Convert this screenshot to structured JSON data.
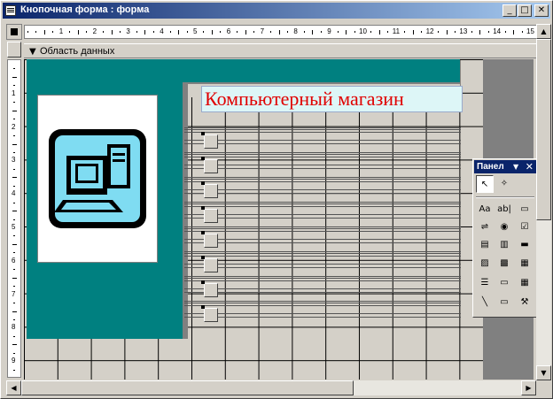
{
  "window": {
    "title": "Кнопочная форма : форма",
    "minimize_glyph": "_",
    "maximize_glyph": "□",
    "close_glyph": "✕"
  },
  "ruler": {
    "h_numbers": [
      "1",
      "2",
      "3",
      "4",
      "5",
      "6",
      "7",
      "8",
      "9",
      "10",
      "11",
      "12",
      "13",
      "14",
      "15"
    ],
    "v_numbers": [
      "1",
      "2",
      "3",
      "4",
      "5",
      "6",
      "7",
      "8",
      "9"
    ]
  },
  "section": {
    "arrow_glyph": "▼",
    "label": "Область данных"
  },
  "form": {
    "title_label": "Компьютерный магазин",
    "switch_button_count": 8,
    "image": "computer-icon"
  },
  "toolbox": {
    "title": "Панел",
    "dropdown_glyph": "▼",
    "close_glyph": "✕",
    "tools": [
      {
        "name": "select-objects-tool",
        "glyph": "↖"
      },
      {
        "name": "control-wizards-tool",
        "glyph": "✧"
      },
      {
        "name": "label-tool",
        "glyph": "Aa"
      },
      {
        "name": "textbox-tool",
        "glyph": "ab|"
      },
      {
        "name": "option-group-tool",
        "glyph": "▭"
      },
      {
        "name": "toggle-button-tool",
        "glyph": "⇌"
      },
      {
        "name": "option-button-tool",
        "glyph": "◉"
      },
      {
        "name": "check-box-tool",
        "glyph": "☑"
      },
      {
        "name": "combo-box-tool",
        "glyph": "▤"
      },
      {
        "name": "list-box-tool",
        "glyph": "▥"
      },
      {
        "name": "command-button-tool",
        "glyph": "▬"
      },
      {
        "name": "image-tool",
        "glyph": "▨"
      },
      {
        "name": "unbound-object-frame-tool",
        "glyph": "▩"
      },
      {
        "name": "bound-object-frame-tool",
        "glyph": "▦"
      },
      {
        "name": "page-break-tool",
        "glyph": "☰"
      },
      {
        "name": "tab-control-tool",
        "glyph": "▭"
      },
      {
        "name": "subform-tool",
        "glyph": "▦"
      },
      {
        "name": "line-tool",
        "glyph": "╲"
      },
      {
        "name": "rectangle-tool",
        "glyph": "▭"
      },
      {
        "name": "more-controls-tool",
        "glyph": "⚒"
      }
    ]
  },
  "colors": {
    "teal": "#008080",
    "title_text": "#e00000",
    "title_bg": "#ddf6f7",
    "caption": "#0a246a"
  }
}
